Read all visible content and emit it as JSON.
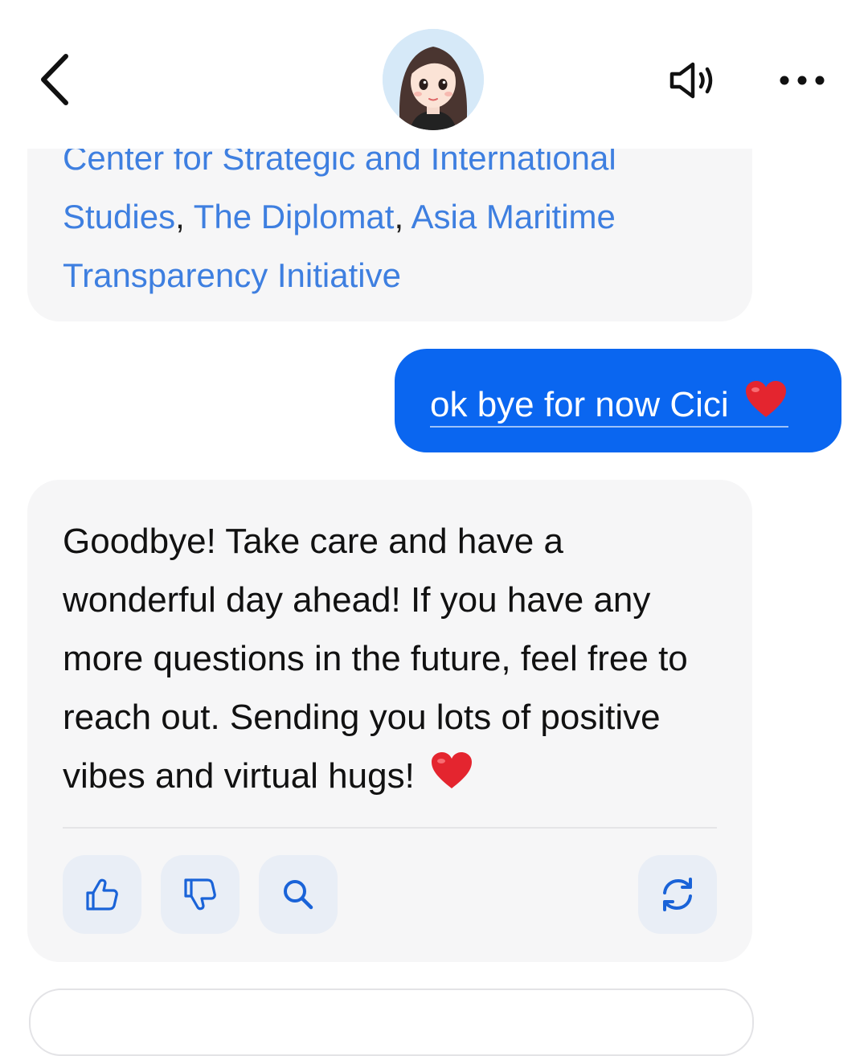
{
  "header": {
    "back_icon": "chevron-left-icon",
    "avatar_icon": "assistant-avatar",
    "speaker_icon": "speaker-volume-icon",
    "more_icon": "more-horizontal-icon"
  },
  "messages": {
    "sources": {
      "links": [
        "Center for Strategic and International",
        "Studies",
        "The Diplomat",
        "Asia Maritime Transparency Initiative"
      ],
      "separator": ","
    },
    "user": {
      "text": "ok bye for now Cici",
      "emoji_icon": "red-heart-icon"
    },
    "reply": {
      "text": "Goodbye! Take care and have a wonderful day ahead! If you have any more questions in the future, feel free to reach out. Sending you lots of positive vibes and virtual hugs!",
      "emoji_icon": "red-heart-icon"
    }
  },
  "actions": [
    {
      "name": "like",
      "icon": "thumbs-up-icon"
    },
    {
      "name": "dislike",
      "icon": "thumbs-down-icon"
    },
    {
      "name": "search",
      "icon": "search-icon"
    },
    {
      "name": "regenerate",
      "icon": "refresh-icon"
    }
  ],
  "colors": {
    "accent": "#0a66f0",
    "link": "#3e7fe0",
    "bubble_bg": "#f6f6f7",
    "action_bg": "#e9eef6",
    "action_icon": "#1a63d8"
  }
}
